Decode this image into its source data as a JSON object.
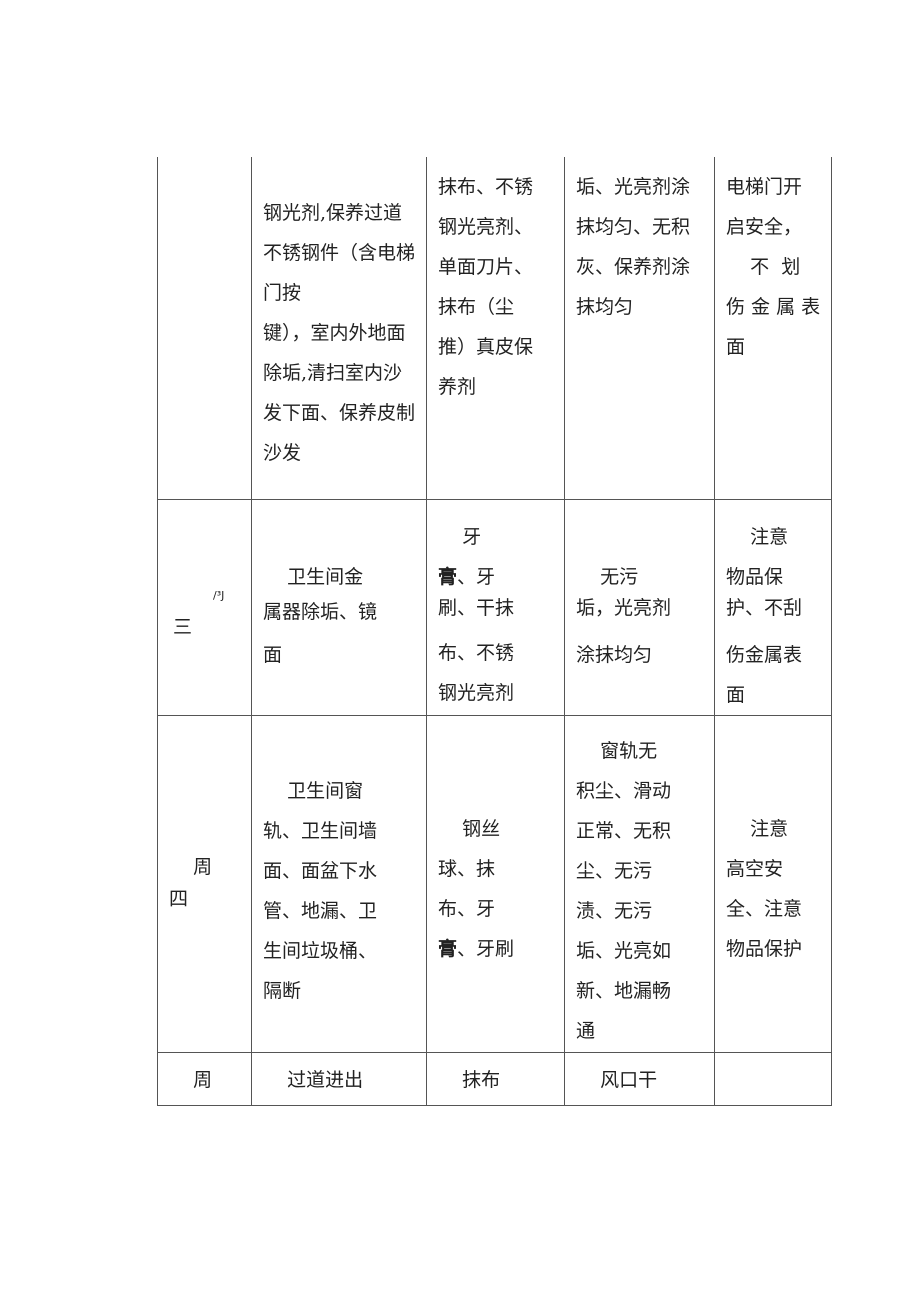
{
  "table": {
    "rows": [
      {
        "day": [],
        "content": [
          "钢光剂,保养过道",
          "不锈钢件（含电梯",
          "门按",
          "键），室内外地面",
          "除垢,清扫室内沙",
          "发下面、保养皮制",
          "沙发"
        ],
        "tools": [
          "抹布、不锈",
          "钢光亮剂、",
          "单面刀片、",
          "抹布（尘",
          "推）真皮保",
          "养剂"
        ],
        "standard": [
          "垢、光亮剂涂",
          "抹均匀、无积",
          "灰、保养剂涂",
          "抹均匀"
        ],
        "notes": [
          "电梯门开",
          "启安全，",
          "    不  划",
          "伤 金 属 表",
          "面"
        ]
      },
      {
        "day": [
          "/³J",
          "三"
        ],
        "content": [
          "    卫生间金",
          "属器除垢、镜",
          "面"
        ],
        "tools_first": "    牙",
        "tools_bold_char": "膏",
        "tools_rest": [
          "、牙",
          "刷、干抹",
          "布、不锈",
          "钢光亮剂"
        ],
        "standard": [
          "    无污",
          "垢，光亮剂",
          "涂抹均匀"
        ],
        "notes": [
          "    注意",
          "物品保",
          "护、不刮",
          "伤金属表",
          "面"
        ]
      },
      {
        "day": [
          "    周",
          "四"
        ],
        "content": [
          "    卫生间窗",
          "轨、卫生间墙",
          "面、面盆下水",
          "管、地漏、卫",
          "生间垃圾桶、",
          "隔断"
        ],
        "tools": [
          "    钢丝",
          "球、抹",
          "布、牙"
        ],
        "tools_bold_char": "膏",
        "tools_last_rest": "、牙刷",
        "standard": [
          "    窗轨无",
          "积尘、滑动",
          "正常、无积",
          "尘、无污",
          "渍、无污",
          "垢、光亮如",
          "新、地漏畅",
          "通"
        ],
        "notes": [
          "    注意",
          "高空安",
          "全、注意",
          "物品保护"
        ]
      },
      {
        "day": [
          "    周"
        ],
        "content": [
          "    过道进出"
        ],
        "tools": [
          "    抹布"
        ],
        "standard": [
          "    风口干"
        ],
        "notes": []
      }
    ]
  }
}
